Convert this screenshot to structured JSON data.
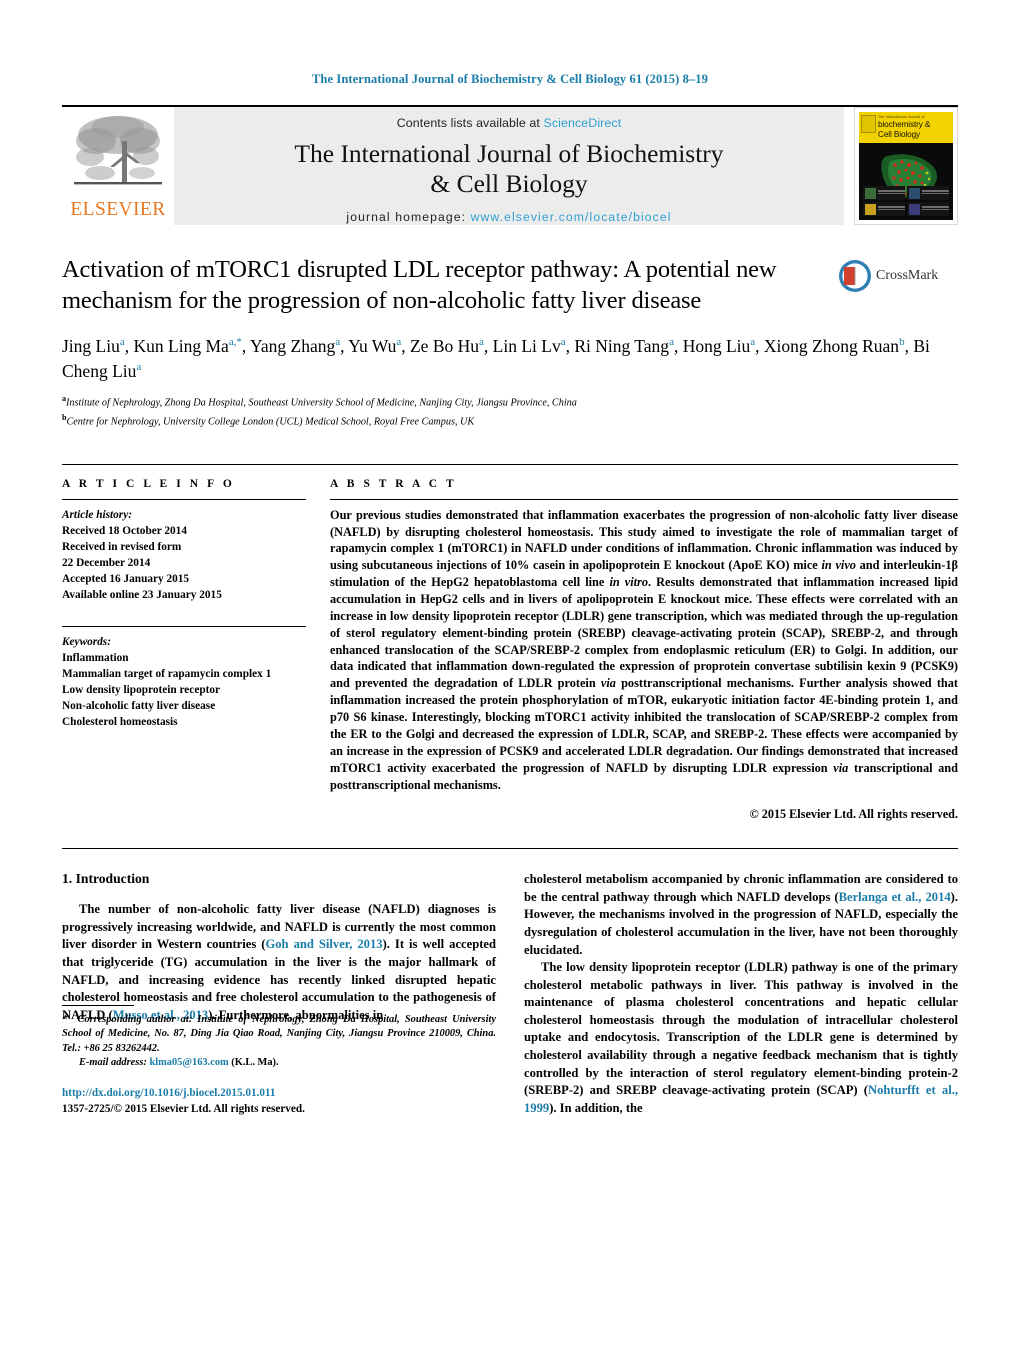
{
  "running_head": "The International Journal of Biochemistry & Cell Biology 61 (2015) 8–19",
  "masthead": {
    "publisher": "ELSEVIER",
    "contents_prefix": "Contents lists available at ",
    "contents_link": "ScienceDirect",
    "journal_title_line1": "The International Journal of Biochemistry",
    "journal_title_line2": "& Cell Biology",
    "homepage_label": "journal homepage: ",
    "homepage_url": "www.elsevier.com/locate/biocel",
    "cover": {
      "kicker": "The International Journal of",
      "line1": "biochemistry &",
      "line2": "Cell Biology"
    }
  },
  "article": {
    "title": "Activation of mTORC1 disrupted LDL receptor pathway: A potential new mechanism for the progression of non-alcoholic fatty liver disease",
    "crossmark_label": "CrossMark",
    "authors_html": "Jing Liu<sup>a</sup>, Kun Ling Ma<sup>a,*</sup>, Yang Zhang<sup>a</sup>, Yu Wu<sup>a</sup>, Ze Bo Hu<sup>a</sup>, Lin Li Lv<sup>a</sup>, Ri Ning Tang<sup>a</sup>, Hong Liu<sup>a</sup>, Xiong Zhong Ruan<sup>b</sup>, Bi Cheng Liu<sup>a</sup>",
    "affiliations": [
      {
        "marker": "a",
        "text": "Institute of Nephrology, Zhong Da Hospital, Southeast University School of Medicine, Nanjing City, Jiangsu Province, China"
      },
      {
        "marker": "b",
        "text": "Centre for Nephrology, University College London (UCL) Medical School, Royal Free Campus, UK"
      }
    ]
  },
  "article_info": {
    "heading": "A R T I C L E    I N F O",
    "history_label": "Article history:",
    "history": [
      "Received 18 October 2014",
      "Received in revised form",
      "22 December 2014",
      "Accepted 16 January 2015",
      "Available online 23 January 2015"
    ],
    "keywords_label": "Keywords:",
    "keywords": [
      "Inflammation",
      "Mammalian target of rapamycin complex 1",
      "Low density lipoprotein receptor",
      "Non-alcoholic fatty liver disease",
      "Cholesterol homeostasis"
    ]
  },
  "abstract": {
    "heading": "A B S T R A C T",
    "text_html": "Our previous studies demonstrated that inflammation exacerbates the progression of non-alcoholic fatty liver disease (NAFLD) by disrupting cholesterol homeostasis. This study aimed to investigate the role of mammalian target of rapamycin complex 1 (mTORC1) in NAFLD under conditions of inflammation. Chronic inflammation was induced by using subcutaneous injections of 10% casein in apolipoprotein E knockout (ApoE KO) mice <em>in vivo</em> and interleukin-1&beta; stimulation of the HepG2 hepatoblastoma cell line <em>in vitro</em>. Results demonstrated that inflammation increased lipid accumulation in HepG2 cells and in livers of apolipoprotein E knockout mice. These effects were correlated with an increase in low density lipoprotein receptor (LDLR) gene transcription, which was mediated through the up-regulation of sterol regulatory element-binding protein (SREBP) cleavage-activating protein (SCAP), SREBP-2, and through enhanced translocation of the SCAP/SREBP-2 complex from endoplasmic reticulum (ER) to Golgi. In addition, our data indicated that inflammation down-regulated the expression of proprotein convertase subtilisin kexin 9 (PCSK9) and prevented the degradation of LDLR protein <em>via</em> posttranscriptional mechanisms. Further analysis showed that inflammation increased the protein phosphorylation of mTOR, eukaryotic initiation factor 4E-binding protein 1, and p70 S6 kinase. Interestingly, blocking mTORC1 activity inhibited the translocation of SCAP/SREBP-2 complex from the ER to the Golgi and decreased the expression of LDLR, SCAP, and SREBP-2. These effects were accompanied by an increase in the expression of PCSK9 and accelerated LDLR degradation. Our findings demonstrated that increased mTORC1 activity exacerbated the progression of NAFLD by disrupting LDLR expression <em>via</em> transcriptional and posttranscriptional mechanisms.",
    "copyright": "© 2015 Elsevier Ltd. All rights reserved."
  },
  "body": {
    "section_number_title": "1.  Introduction",
    "left_paragraphs_html": [
      "The number of non-alcoholic fatty liver disease (NAFLD) diagnoses is progressively increasing worldwide, and NAFLD is currently the most common liver disorder in Western countries (<span class=\"cit\">Goh and Silver, 2013</span>). It is well accepted that triglyceride (TG) accumulation in the liver is the major hallmark of NAFLD, and increasing evidence has recently linked disrupted hepatic cholesterol homeostasis and free cholesterol accumulation to the pathogenesis of NAFLD (<span class=\"cit\">Musso et al., 2013</span>). Furthermore, abnormalities in"
    ],
    "right_paragraphs_html": [
      "cholesterol metabolism accompanied by chronic inflammation are considered to be the central pathway through which NAFLD develops (<span class=\"cit\">Berlanga et al., 2014</span>). However, the mechanisms involved in the progression of NAFLD, especially the dysregulation of cholesterol accumulation in the liver, have not been thoroughly elucidated.",
      "The low density lipoprotein receptor (LDLR) pathway is one of the primary cholesterol metabolic pathways in liver. This pathway is involved in the maintenance of plasma cholesterol concentrations and hepatic cellular cholesterol homeostasis through the modulation of intracellular cholesterol uptake and endocytosis. Transcription of the LDLR gene is determined by cholesterol availability through a negative feedback mechanism that is tightly controlled by the interaction of sterol regulatory element-binding protein-2 (SREBP-2) and SREBP cleavage-activating protein (SCAP) (<span class=\"cit\">Nohturfft et al., 1999</span>). In addition, the"
    ]
  },
  "footnote": {
    "corresponding_html": "<span class=\"it\">*</span>&nbsp; <span class=\"it\">Corresponding author at: Institute of Nephrology, Zhong Da Hospital, Southeast University School of Medicine, No. 87, Ding Jia Qiao Road, Nanjing City, Jiangsu Province 210009, China. Tel.: +86 25 83262442.</span>",
    "email_label": "E-mail address:",
    "email": "klma05@163.com",
    "email_suffix": "(K.L. Ma).",
    "doi_url": "http://dx.doi.org/10.1016/j.biocel.2015.01.011",
    "issn_line": "1357-2725/© 2015 Elsevier Ltd. All rights reserved."
  },
  "colors": {
    "link": "#1a7ca8",
    "sciencedirect": "#2f9fd0",
    "elsevier_orange": "#E87722",
    "cover_yellow": "#F2D200"
  }
}
